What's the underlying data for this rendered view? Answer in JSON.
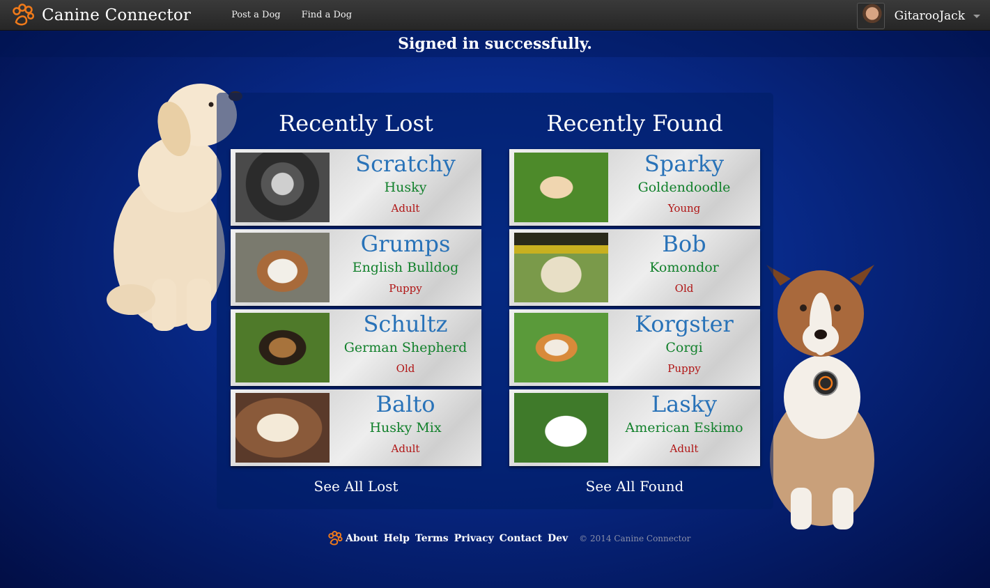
{
  "navbar": {
    "brand": "Canine Connector",
    "links": [
      "Post a Dog",
      "Find a Dog"
    ],
    "username": "GitarooJack"
  },
  "flash": "Signed in successfully.",
  "lost": {
    "title": "Recently Lost",
    "see_all": "See All Lost",
    "dogs": [
      {
        "name": "Scratchy",
        "breed": "Husky",
        "age": "Adult"
      },
      {
        "name": "Grumps",
        "breed": "English Bulldog",
        "age": "Puppy"
      },
      {
        "name": "Schultz",
        "breed": "German Shepherd",
        "age": "Old"
      },
      {
        "name": "Balto",
        "breed": "Husky Mix",
        "age": "Adult"
      }
    ]
  },
  "found": {
    "title": "Recently Found",
    "see_all": "See All Found",
    "dogs": [
      {
        "name": "Sparky",
        "breed": "Goldendoodle",
        "age": "Young"
      },
      {
        "name": "Bob",
        "breed": "Komondor",
        "age": "Old"
      },
      {
        "name": "Korgster",
        "breed": "Corgi",
        "age": "Puppy"
      },
      {
        "name": "Lasky",
        "breed": "American Eskimo",
        "age": "Adult"
      }
    ]
  },
  "footer": {
    "links": [
      "About",
      "Help",
      "Terms",
      "Privacy",
      "Contact",
      "Dev"
    ],
    "copyright": "© 2014 Canine Connector"
  },
  "colors": {
    "name": "#2872b8",
    "breed": "#11802b",
    "age": "#b01414",
    "paw": "#f07a1a"
  }
}
